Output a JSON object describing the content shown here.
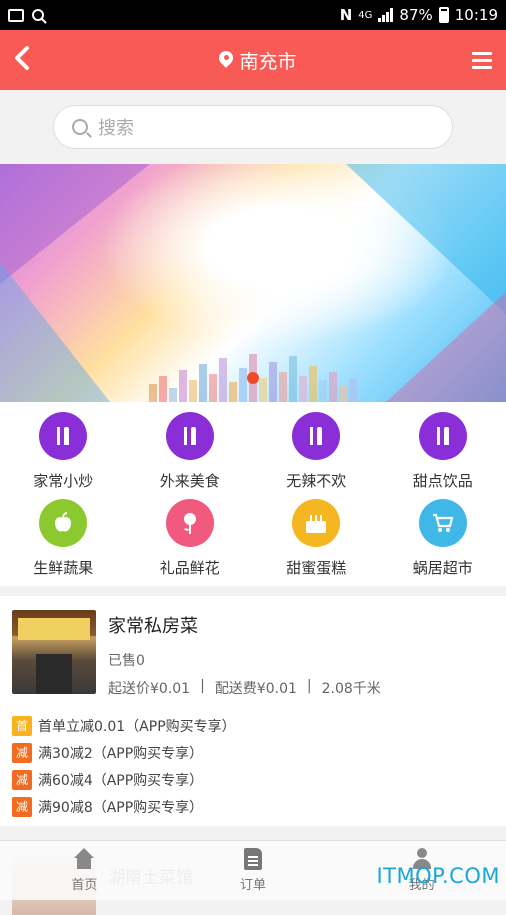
{
  "status_bar": {
    "battery": "87%",
    "time": "10:19",
    "network": "4G"
  },
  "header": {
    "city": "南充市"
  },
  "search": {
    "placeholder": "搜索"
  },
  "banner": {
    "dots": 1
  },
  "categories": [
    {
      "label": "家常小炒",
      "icon": "cutlery-icon",
      "color": "#8a2ed8"
    },
    {
      "label": "外来美食",
      "icon": "cutlery-icon",
      "color": "#8a2ed8"
    },
    {
      "label": "无辣不欢",
      "icon": "cutlery-icon",
      "color": "#8a2ed8"
    },
    {
      "label": "甜点饮品",
      "icon": "cutlery-icon",
      "color": "#8a2ed8"
    },
    {
      "label": "生鲜蔬果",
      "icon": "apple-icon",
      "color": "#8cc92e"
    },
    {
      "label": "礼品鲜花",
      "icon": "flower-icon",
      "color": "#f05a7e"
    },
    {
      "label": "甜蜜蛋糕",
      "icon": "cake-icon",
      "color": "#f5b621"
    },
    {
      "label": "蜗居超市",
      "icon": "cart-icon",
      "color": "#3fb8e8"
    }
  ],
  "shop": {
    "name": "家常私房菜",
    "sold": "已售0",
    "min_price": "起送价¥0.01",
    "delivery_fee": "配送费¥0.01",
    "distance": "2.08千米",
    "promos": [
      {
        "tag": "首",
        "text": "首单立减0.01（APP购买专享）"
      },
      {
        "tag": "减",
        "text": "满30减2（APP购买专享）"
      },
      {
        "tag": "减",
        "text": "满60减4（APP购买专享）"
      },
      {
        "tag": "减",
        "text": "满90减8（APP购买专享）"
      }
    ]
  },
  "next_shop": {
    "name": "湖南土菜馆"
  },
  "tabs": [
    {
      "label": "首页",
      "icon": "home-icon"
    },
    {
      "label": "订单",
      "icon": "order-icon"
    },
    {
      "label": "我的",
      "icon": "user-icon"
    }
  ],
  "watermark": "ITMOP.COM",
  "colors": {
    "accent": "#f85a55",
    "tag_first": "#f7b21c",
    "tag_minus": "#f26b21"
  }
}
